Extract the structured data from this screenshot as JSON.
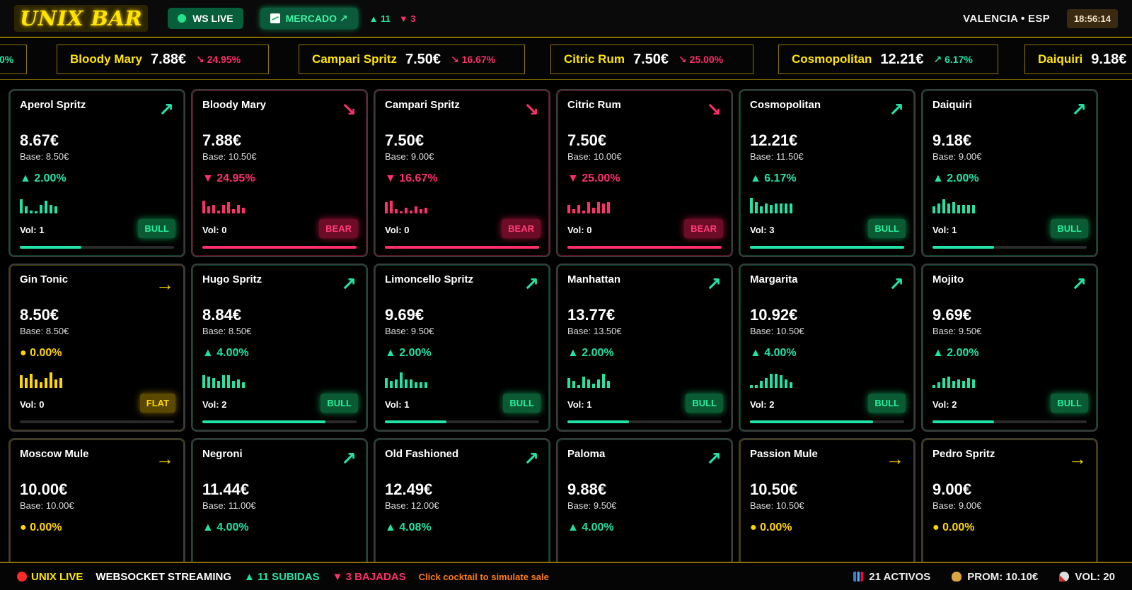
{
  "header": {
    "logo": "UNIX BAR",
    "ws_live": "WS LIVE",
    "market": "MERCADO ↗",
    "up_count": "▲ 11",
    "down_count": "▼ 3",
    "location": "VALENCIA • ESP",
    "clock": "18:56:14"
  },
  "ticker": [
    {
      "name": "",
      "price": "",
      "change": "0%",
      "dir": "up"
    },
    {
      "name": "Bloody Mary",
      "price": "7.88€",
      "change": "↘ 24.95%",
      "dir": "down"
    },
    {
      "name": "Campari Spritz",
      "price": "7.50€",
      "change": "↘ 16.67%",
      "dir": "down"
    },
    {
      "name": "Citric Rum",
      "price": "7.50€",
      "change": "↘ 25.00%",
      "dir": "down"
    },
    {
      "name": "Cosmopolitan",
      "price": "12.21€",
      "change": "↗ 6.17%",
      "dir": "up"
    },
    {
      "name": "Daiquiri",
      "price": "9.18€",
      "change": "",
      "dir": "up"
    }
  ],
  "cards": [
    {
      "name": "Aperol Spritz",
      "price": "8.67€",
      "base": "Base: 8.50€",
      "change": "▲ 2.00%",
      "trend": "up",
      "arrow": "↗",
      "vol": "Vol: 1",
      "badge": "BULL",
      "progress": 0.4,
      "spark": [
        20,
        10,
        4,
        3,
        12,
        18,
        12,
        10
      ]
    },
    {
      "name": "Bloody Mary",
      "price": "7.88€",
      "base": "Base: 10.50€",
      "change": "▼ 24.95%",
      "trend": "down",
      "arrow": "↘",
      "vol": "Vol: 0",
      "badge": "BEAR",
      "progress": 1.0,
      "spark": [
        18,
        10,
        12,
        4,
        12,
        16,
        6,
        12,
        8
      ]
    },
    {
      "name": "Campari Spritz",
      "price": "7.50€",
      "base": "Base: 9.00€",
      "change": "▼ 16.67%",
      "trend": "down",
      "arrow": "↘",
      "vol": "Vol: 0",
      "badge": "BEAR",
      "progress": 1.0,
      "spark": [
        16,
        18,
        6,
        3,
        8,
        4,
        10,
        6,
        8
      ]
    },
    {
      "name": "Citric Rum",
      "price": "7.50€",
      "base": "Base: 10.00€",
      "change": "▼ 25.00%",
      "trend": "down",
      "arrow": "↘",
      "vol": "Vol: 0",
      "badge": "BEAR",
      "progress": 1.0,
      "spark": [
        12,
        6,
        12,
        4,
        16,
        8,
        16,
        14,
        16
      ]
    },
    {
      "name": "Cosmopolitan",
      "price": "12.21€",
      "base": "Base: 11.50€",
      "change": "▲ 6.17%",
      "trend": "up",
      "arrow": "↗",
      "vol": "Vol: 3",
      "badge": "BULL",
      "progress": 1.0,
      "spark": [
        22,
        16,
        10,
        14,
        12,
        14,
        14,
        14,
        14
      ]
    },
    {
      "name": "Daiquiri",
      "price": "9.18€",
      "base": "Base: 9.00€",
      "change": "▲ 2.00%",
      "trend": "up",
      "arrow": "↗",
      "vol": "Vol: 1",
      "badge": "BULL",
      "progress": 0.4,
      "spark": [
        10,
        14,
        20,
        14,
        16,
        12,
        12,
        12,
        12
      ]
    },
    {
      "name": "Gin Tonic",
      "price": "8.50€",
      "base": "Base: 8.50€",
      "change": "● 0.00%",
      "trend": "flat",
      "arrow": "→",
      "vol": "Vol: 0",
      "badge": "FLAT",
      "progress": 0.0,
      "spark": [
        18,
        14,
        20,
        12,
        8,
        14,
        22,
        12,
        14
      ]
    },
    {
      "name": "Hugo Spritz",
      "price": "8.84€",
      "base": "Base: 8.50€",
      "change": "▲ 4.00%",
      "trend": "up",
      "arrow": "↗",
      "vol": "Vol: 2",
      "badge": "BULL",
      "progress": 0.8,
      "spark": [
        18,
        16,
        14,
        10,
        18,
        18,
        10,
        12,
        8
      ]
    },
    {
      "name": "Limoncello Spritz",
      "price": "9.69€",
      "base": "Base: 9.50€",
      "change": "▲ 2.00%",
      "trend": "up",
      "arrow": "↗",
      "vol": "Vol: 1",
      "badge": "BULL",
      "progress": 0.4,
      "spark": [
        14,
        10,
        12,
        22,
        12,
        12,
        8,
        8,
        8
      ]
    },
    {
      "name": "Manhattan",
      "price": "13.77€",
      "base": "Base: 13.50€",
      "change": "▲ 2.00%",
      "trend": "up",
      "arrow": "↗",
      "vol": "Vol: 1",
      "badge": "BULL",
      "progress": 0.4,
      "spark": [
        14,
        10,
        4,
        16,
        12,
        6,
        12,
        20,
        10
      ]
    },
    {
      "name": "Margarita",
      "price": "10.92€",
      "base": "Base: 10.50€",
      "change": "▲ 4.00%",
      "trend": "up",
      "arrow": "↗",
      "vol": "Vol: 2",
      "badge": "BULL",
      "progress": 0.8,
      "spark": [
        4,
        4,
        10,
        14,
        20,
        20,
        18,
        12,
        8
      ]
    },
    {
      "name": "Mojito",
      "price": "9.69€",
      "base": "Base: 9.50€",
      "change": "▲ 2.00%",
      "trend": "up",
      "arrow": "↗",
      "vol": "Vol: 2",
      "badge": "BULL",
      "progress": 0.4,
      "spark": [
        4,
        8,
        14,
        16,
        10,
        12,
        10,
        14,
        12
      ]
    },
    {
      "name": "Moscow Mule",
      "price": "10.00€",
      "base": "Base: 10.00€",
      "change": "● 0.00%",
      "trend": "flat",
      "arrow": "→",
      "vol": "",
      "badge": "",
      "progress": 0.0,
      "spark": []
    },
    {
      "name": "Negroni",
      "price": "11.44€",
      "base": "Base: 11.00€",
      "change": "▲ 4.00%",
      "trend": "up",
      "arrow": "↗",
      "vol": "",
      "badge": "",
      "progress": 0.0,
      "spark": []
    },
    {
      "name": "Old Fashioned",
      "price": "12.49€",
      "base": "Base: 12.00€",
      "change": "▲ 4.08%",
      "trend": "up",
      "arrow": "↗",
      "vol": "",
      "badge": "",
      "progress": 0.0,
      "spark": []
    },
    {
      "name": "Paloma",
      "price": "9.88€",
      "base": "Base: 9.50€",
      "change": "▲ 4.00%",
      "trend": "up",
      "arrow": "↗",
      "vol": "",
      "badge": "",
      "progress": 0.0,
      "spark": []
    },
    {
      "name": "Passion Mule",
      "price": "10.50€",
      "base": "Base: 10.50€",
      "change": "● 0.00%",
      "trend": "flat",
      "arrow": "→",
      "vol": "",
      "badge": "",
      "progress": 0.0,
      "spark": []
    },
    {
      "name": "Pedro Spritz",
      "price": "9.00€",
      "base": "Base: 9.00€",
      "change": "● 0.00%",
      "trend": "flat",
      "arrow": "→",
      "vol": "",
      "badge": "",
      "progress": 0.0,
      "spark": []
    }
  ],
  "footer": {
    "live": "UNIX LIVE",
    "ws": "WEBSOCKET STREAMING",
    "ups": "▲ 11 SUBIDAS",
    "downs": "▼ 3 BAJADAS",
    "hint": "Click cocktail to simulate sale",
    "assets": "21 ACTIVOS",
    "avg": "PROM: 10.10€",
    "vol": "VOL: 20"
  },
  "colors": {
    "up": "#22e3a7",
    "down": "#ff2e6d",
    "flat": "#ffd600",
    "accent": "#ffe600"
  }
}
